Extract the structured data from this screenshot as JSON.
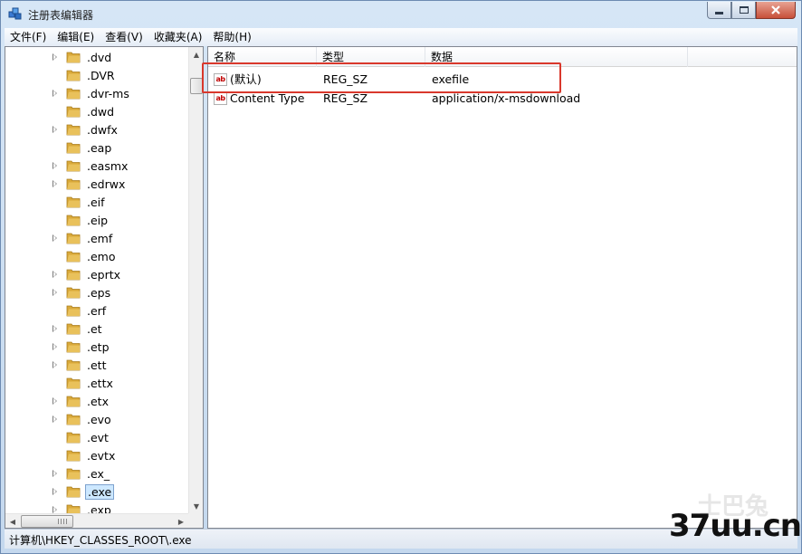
{
  "window": {
    "title": "注册表编辑器"
  },
  "menu": [
    "文件(F)",
    "编辑(E)",
    "查看(V)",
    "收藏夹(A)",
    "帮助(H)"
  ],
  "tree": {
    "items": [
      {
        "label": ".dvd",
        "expandable": true
      },
      {
        "label": ".DVR",
        "expandable": false
      },
      {
        "label": ".dvr-ms",
        "expandable": true
      },
      {
        "label": ".dwd",
        "expandable": false
      },
      {
        "label": ".dwfx",
        "expandable": true
      },
      {
        "label": ".eap",
        "expandable": false
      },
      {
        "label": ".easmx",
        "expandable": true
      },
      {
        "label": ".edrwx",
        "expandable": true
      },
      {
        "label": ".eif",
        "expandable": false
      },
      {
        "label": ".eip",
        "expandable": false
      },
      {
        "label": ".emf",
        "expandable": true
      },
      {
        "label": ".emo",
        "expandable": false
      },
      {
        "label": ".eprtx",
        "expandable": true
      },
      {
        "label": ".eps",
        "expandable": true
      },
      {
        "label": ".erf",
        "expandable": false
      },
      {
        "label": ".et",
        "expandable": true
      },
      {
        "label": ".etp",
        "expandable": true
      },
      {
        "label": ".ett",
        "expandable": true
      },
      {
        "label": ".ettx",
        "expandable": false
      },
      {
        "label": ".etx",
        "expandable": true
      },
      {
        "label": ".evo",
        "expandable": true
      },
      {
        "label": ".evt",
        "expandable": false
      },
      {
        "label": ".evtx",
        "expandable": false
      },
      {
        "label": ".ex_",
        "expandable": true
      },
      {
        "label": ".exe",
        "expandable": true,
        "selected": true
      },
      {
        "label": ".exp",
        "expandable": true
      }
    ]
  },
  "list": {
    "columns": [
      "名称",
      "类型",
      "数据"
    ],
    "rows": [
      {
        "name": "(默认)",
        "type": "REG_SZ",
        "data": "exefile"
      },
      {
        "name": "Content Type",
        "type": "REG_SZ",
        "data": "application/x-msdownload"
      }
    ],
    "value_icon": "ab"
  },
  "status": {
    "path": "计算机\\HKEY_CLASSES_ROOT\\.exe"
  },
  "watermark": {
    "main": "37uu.cn",
    "faint": "士巴兔"
  },
  "colors": {
    "highlight_box": "#d9382c",
    "selection": "#cde8ff",
    "folder": "#e9c15b"
  },
  "icons": {
    "app": "registry-editor-icon",
    "minimize": "minimize-icon",
    "maximize": "maximize-icon",
    "close": "close-icon",
    "folder": "folder-icon",
    "value": "string-value-icon"
  }
}
